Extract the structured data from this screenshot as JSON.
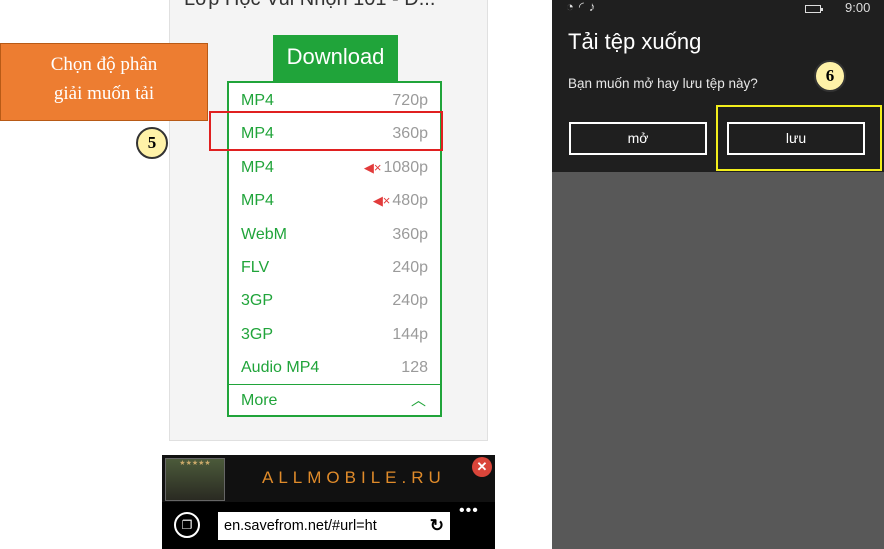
{
  "left_phone": {
    "video_title": "Lớp Học Vui Nhộn 101 - D...",
    "download_label": "Download",
    "formats": [
      {
        "format": "MP4",
        "resolution": "720p",
        "muted": false
      },
      {
        "format": "MP4",
        "resolution": "360p",
        "muted": false
      },
      {
        "format": "MP4",
        "resolution": "1080p",
        "muted": true
      },
      {
        "format": "MP4",
        "resolution": "480p",
        "muted": true
      },
      {
        "format": "WebM",
        "resolution": "360p",
        "muted": false
      },
      {
        "format": "FLV",
        "resolution": "240p",
        "muted": false
      },
      {
        "format": "3GP",
        "resolution": "240p",
        "muted": false
      },
      {
        "format": "3GP",
        "resolution": "144p",
        "muted": false
      },
      {
        "format": "Audio MP4",
        "resolution": "128",
        "muted": false
      }
    ],
    "more_label": "More",
    "ad_text": "ALLMOBILE.RU",
    "url": "en.savefrom.net/#url=ht"
  },
  "annotation": {
    "callout_line1": "Chọn độ phân",
    "callout_line2": "giải muốn tải",
    "step5": "5",
    "step6": "6"
  },
  "right_phone": {
    "status_time": "9:00",
    "dialog_title": "Tải tệp xuống",
    "dialog_message": "Bạn muốn mở hay lưu tệp này?",
    "open_label": "mở",
    "save_label": "lưu"
  },
  "colors": {
    "accent_green": "#20a43a",
    "highlight_red": "#e02020",
    "highlight_yellow": "#f2ee1c",
    "callout_orange": "#ed7d31"
  }
}
